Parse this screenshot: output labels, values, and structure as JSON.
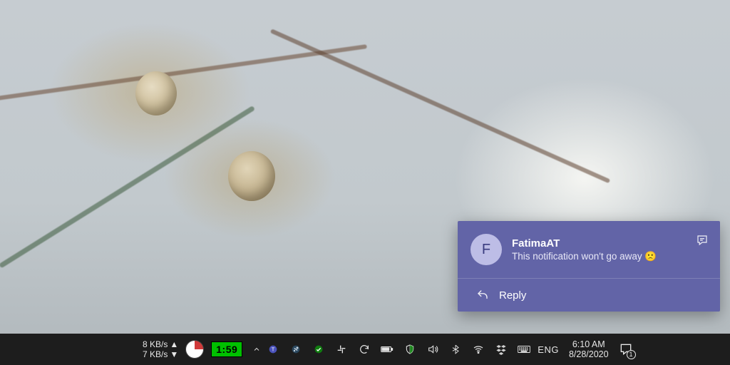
{
  "notification": {
    "sender": "FatimaAT",
    "avatar_initial": "F",
    "message": "This notification won't go away 🙁",
    "reply_label": "Reply"
  },
  "taskbar": {
    "net_up": "8 KB/s",
    "net_down": "7 KB/s",
    "timer": "1:59",
    "language": "ENG",
    "time": "6:10 AM",
    "date": "8/28/2020",
    "notification_count": "1",
    "tray_icons": [
      "teams",
      "steam",
      "check",
      "slack",
      "sync",
      "battery",
      "security",
      "volume",
      "bluetooth",
      "wifi",
      "dropbox",
      "keyboard"
    ]
  }
}
